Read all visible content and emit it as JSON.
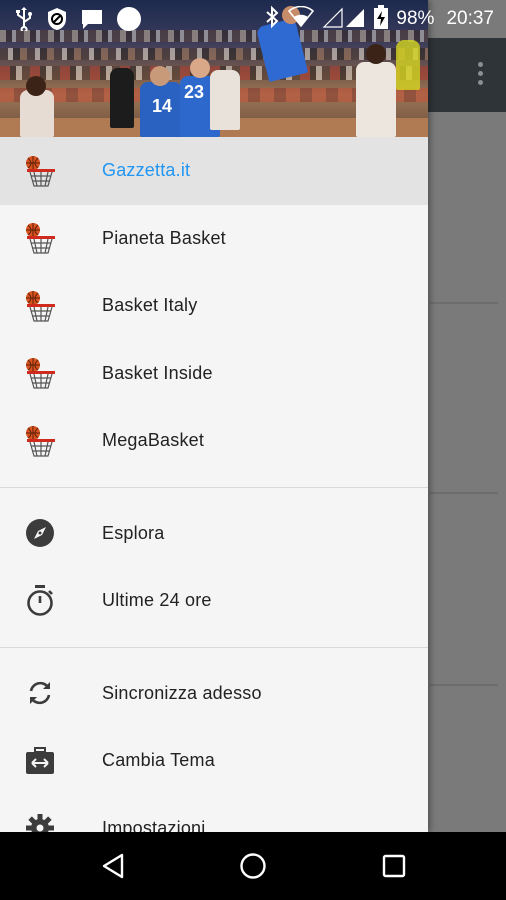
{
  "status_bar": {
    "battery_percent": "98%",
    "time": "20:37",
    "left_icons": [
      "usb-icon",
      "blocked-icon",
      "message-icon",
      "circle-icon"
    ],
    "right_icons": [
      "bluetooth-icon",
      "wifi-icon",
      "signal-icon",
      "battery-charging-icon"
    ]
  },
  "header": {
    "jersey_numbers": [
      "14",
      "23"
    ]
  },
  "drawer": {
    "sources": [
      {
        "label": "Gazzetta.it",
        "icon": "basketball-hoop-icon",
        "active": true
      },
      {
        "label": "Pianeta Basket",
        "icon": "basketball-hoop-icon",
        "active": false
      },
      {
        "label": "Basket Italy",
        "icon": "basketball-hoop-icon",
        "active": false
      },
      {
        "label": "Basket Inside",
        "icon": "basketball-hoop-icon",
        "active": false
      },
      {
        "label": "MegaBasket",
        "icon": "basketball-hoop-icon",
        "active": false
      }
    ],
    "browse": [
      {
        "label": "Esplora",
        "icon": "compass-icon"
      },
      {
        "label": "Ultime 24 ore",
        "icon": "timer-icon"
      }
    ],
    "actions": [
      {
        "label": "Sincronizza adesso",
        "icon": "sync-icon"
      },
      {
        "label": "Cambia Tema",
        "icon": "switch-theme-icon"
      },
      {
        "label": "Impostazioni",
        "icon": "gear-icon"
      }
    ]
  },
  "colors": {
    "active_label": "#2196f3",
    "active_background": "#e3e3e3",
    "drawer_background": "#f5f5f5",
    "toolbar": "#2f3439"
  },
  "nav_bar": {
    "buttons": [
      "back-icon",
      "home-icon",
      "recents-icon"
    ]
  }
}
